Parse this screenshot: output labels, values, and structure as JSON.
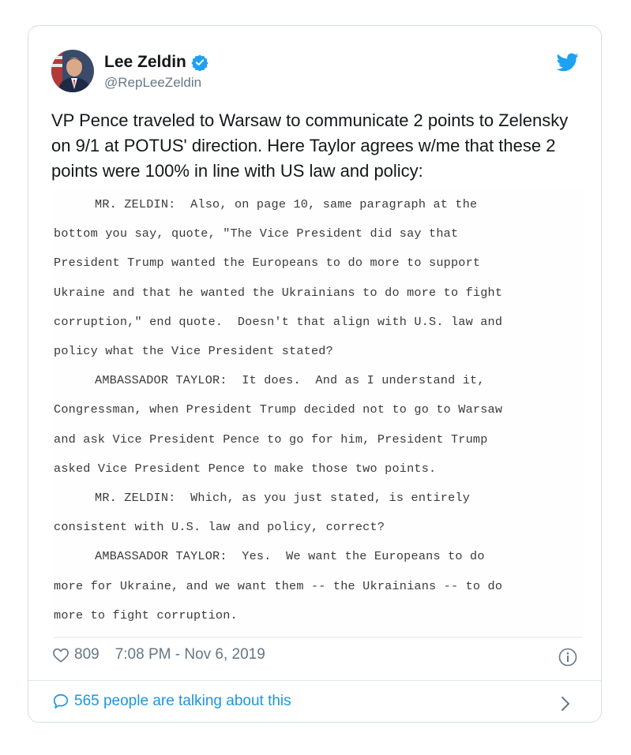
{
  "tweet": {
    "author_name": "Lee Zeldin",
    "author_handle": "@RepLeeZeldin",
    "text": "VP Pence traveled to Warsaw to communicate 2 points to Zelensky on 9/1 at POTUS' direction. Here Taylor agrees w/me that these 2 points were 100% in line with US law and policy:",
    "likes": "809",
    "timestamp": "7:08 PM - Nov 6, 2019",
    "conversation": "565 people are talking about this"
  },
  "transcript": {
    "lines": [
      "MR. ZELDIN:  Also, on page 10, same paragraph at the",
      "bottom you say, quote, \"The Vice President did say that",
      "President Trump wanted the Europeans to do more to support",
      "Ukraine and that he wanted the Ukrainians to do more to fight",
      "corruption,\" end quote.  Doesn't that align with U.S. law and",
      "policy what the Vice President stated?",
      "AMBASSADOR TAYLOR:  It does.  And as I understand it,",
      "Congressman, when President Trump decided not to go to Warsaw",
      "and ask Vice President Pence to go for him, President Trump",
      "asked Vice President Pence to make those two points.",
      "MR. ZELDIN:  Which, as you just stated, is entirely",
      "consistent with U.S. law and policy, correct?",
      "AMBASSADOR TAYLOR:  Yes.  We want the Europeans to do",
      "more for Ukraine, and we want them -- the Ukrainians -- to do",
      "more to fight corruption."
    ]
  },
  "icons": {
    "verified": "verified-badge-icon",
    "platform": "bird-icon",
    "like": "heart-icon",
    "info": "info-icon",
    "reply": "speech-bubble-icon",
    "more": "chevron-right-icon"
  },
  "colors": {
    "accent": "#1b95e0",
    "verified": "#1da1f2",
    "muted_text": "#657786",
    "primary_text": "#14171a"
  }
}
